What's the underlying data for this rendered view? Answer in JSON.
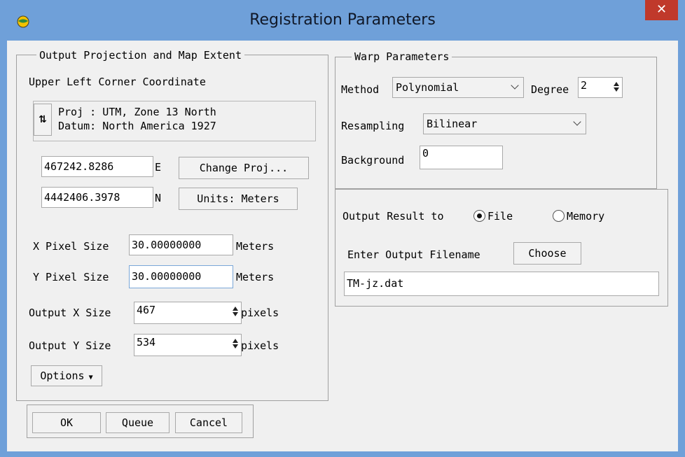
{
  "window": {
    "title": "Registration Parameters"
  },
  "output_group": {
    "legend": "Output Projection and Map Extent",
    "upper_left_label": "Upper Left Corner Coordinate",
    "proj_line": "Proj : UTM, Zone 13 North",
    "datum_line": "Datum: North America 1927",
    "easting_value": "467242.8286",
    "easting_unit": "E",
    "northing_value": "4442406.3978",
    "northing_unit": "N",
    "change_proj_label": "Change Proj...",
    "units_label": "Units: Meters",
    "x_pixel_label": "X Pixel Size",
    "x_pixel_value": "30.00000000",
    "x_pixel_unit": "Meters",
    "y_pixel_label": "Y Pixel Size",
    "y_pixel_value": "30.00000000",
    "y_pixel_unit": "Meters",
    "out_x_label": "Output X Size",
    "out_x_value": "467",
    "out_x_unit": "pixels",
    "out_y_label": "Output Y Size",
    "out_y_value": "534",
    "out_y_unit": "pixels",
    "options_label": "Options"
  },
  "warp_group": {
    "legend": "Warp Parameters",
    "method_label": "Method",
    "method_value": "Polynomial",
    "degree_label": "Degree",
    "degree_value": "2",
    "resampling_label": "Resampling",
    "resampling_value": "Bilinear",
    "background_label": "Background",
    "background_value": "0"
  },
  "output_result": {
    "label": "Output Result to",
    "file_label": "File",
    "memory_label": "Memory",
    "selected": "File",
    "filename_label": "Enter Output Filename",
    "choose_label": "Choose",
    "filename_value": "TM-jz.dat"
  },
  "buttons": {
    "ok": "OK",
    "queue": "Queue",
    "cancel": "Cancel"
  },
  "colors": {
    "titlebar": "#6fa0d9",
    "close": "#c0392b",
    "client": "#f0f0f0"
  }
}
